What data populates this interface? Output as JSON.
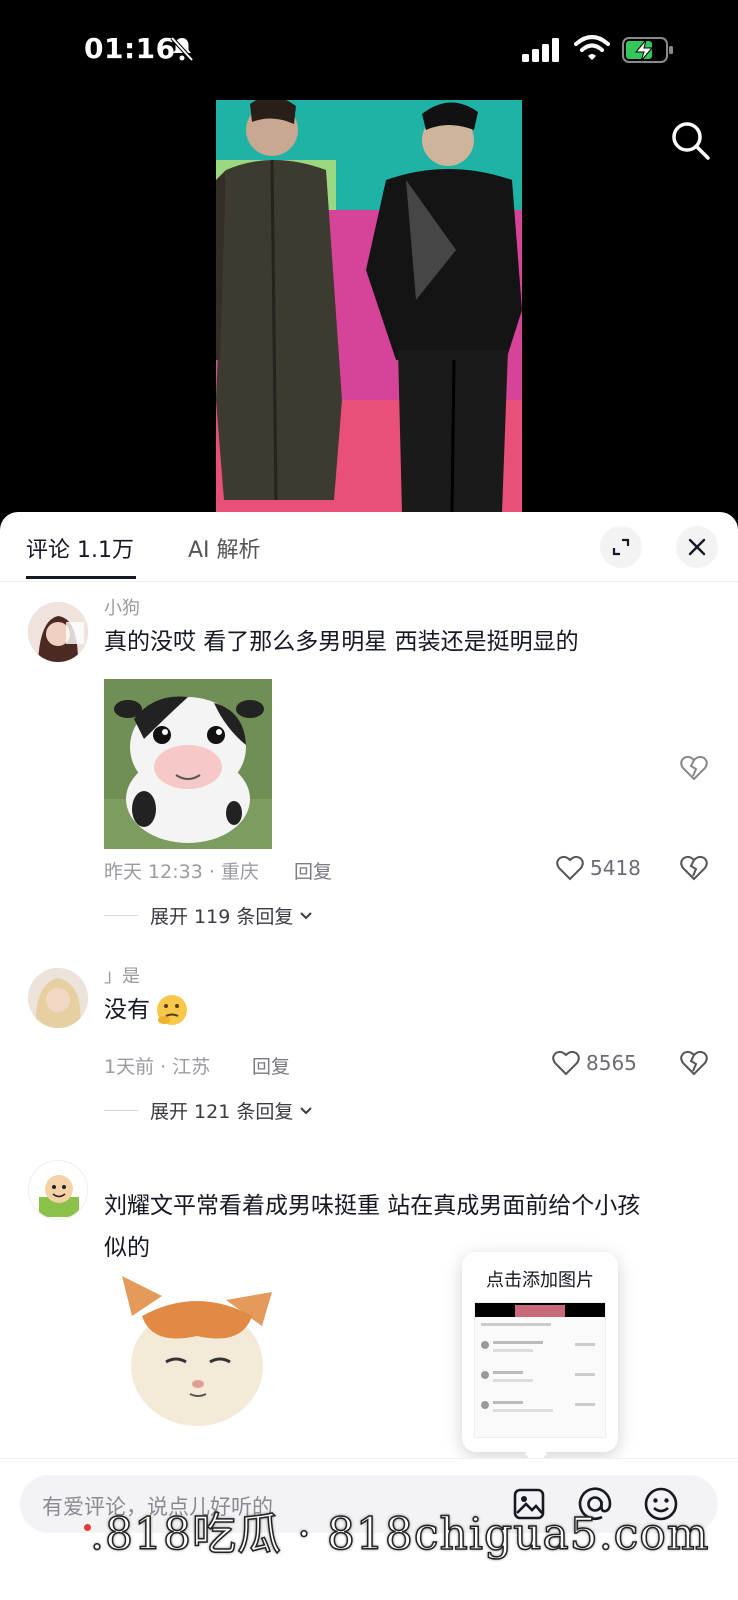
{
  "status_bar": {
    "time": "01:16"
  },
  "tabs": {
    "comments": "评论 1.1万",
    "ai": "AI 解析"
  },
  "comments": [
    {
      "username": "小狗",
      "text": "真的没哎 看了那么多男明星 西装还是挺明显的",
      "meta": "昨天 12:33 · 重庆",
      "reply": "回复",
      "likes": "5418",
      "expand": "展开 119 条回复"
    },
    {
      "username": "」是",
      "text": "没有",
      "meta": "1天前 · 江苏",
      "reply": "回复",
      "likes": "8565",
      "expand": "展开 121 条回复"
    },
    {
      "username": "",
      "text_line1": "刘耀文平常看着成男味挺重 站在真成男面前给个小孩",
      "text_line2": "似的"
    }
  ],
  "popup": {
    "title": "点击添加图片"
  },
  "input": {
    "placeholder": "有爱评论，说点儿好听的"
  },
  "watermark": ".818吃瓜 · 818chigua5.com",
  "icons": [
    "bell-off-icon",
    "signal-icon",
    "wifi-icon",
    "battery-charging-icon",
    "search-icon",
    "expand-icon",
    "close-icon",
    "heart-icon",
    "broken-heart-icon",
    "chevron-down-icon",
    "image-icon",
    "at-icon",
    "emoji-icon"
  ],
  "colors": {
    "text": "#161823",
    "muted": "#9a9aa2",
    "battery": "#34c759"
  }
}
